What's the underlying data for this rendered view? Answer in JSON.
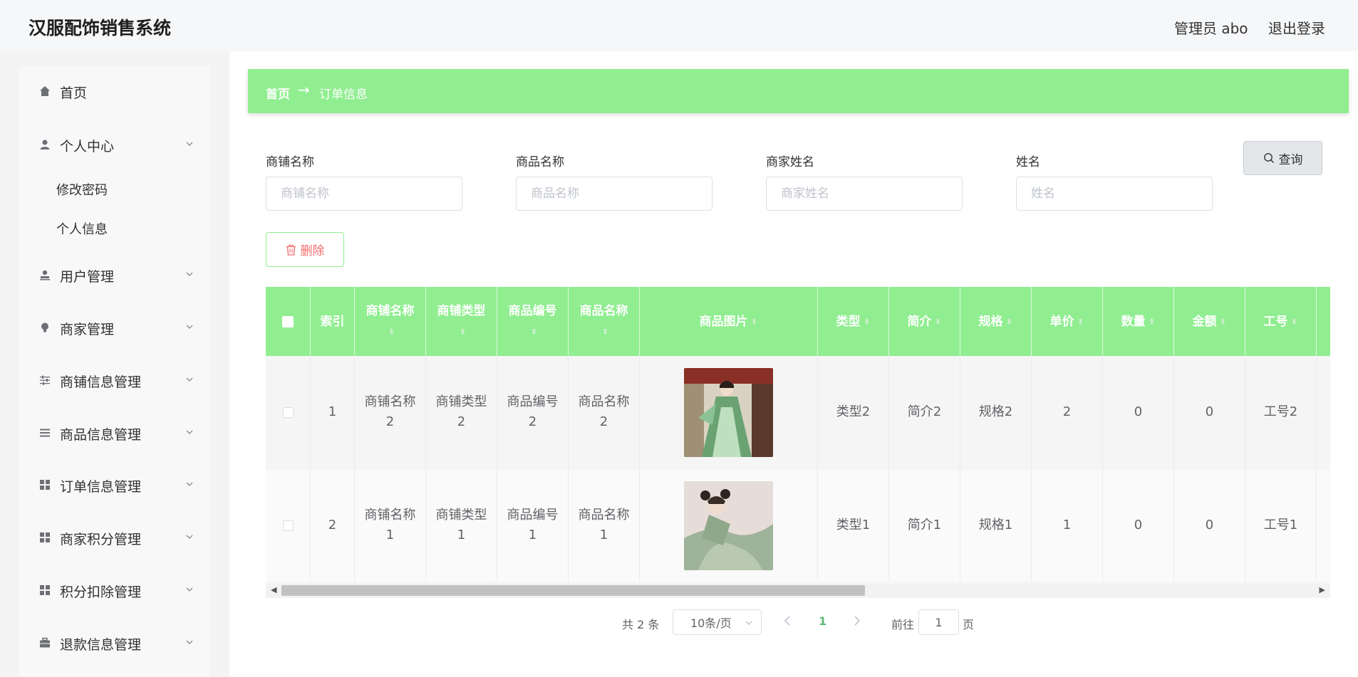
{
  "app": {
    "title": "汉服配饰销售系统"
  },
  "header": {
    "user_label": "管理员 abo",
    "logout_label": "退出登录"
  },
  "sidebar": {
    "items": [
      {
        "label": "首页",
        "icon": "home-icon"
      },
      {
        "label": "个人中心",
        "icon": "user-icon",
        "children": [
          "修改密码",
          "个人信息"
        ]
      },
      {
        "label": "用户管理",
        "icon": "user-stamp-icon"
      },
      {
        "label": "商家管理",
        "icon": "bulb-icon"
      },
      {
        "label": "商铺信息管理",
        "icon": "sliders-icon"
      },
      {
        "label": "商品信息管理",
        "icon": "list-icon"
      },
      {
        "label": "订单信息管理",
        "icon": "grid-icon"
      },
      {
        "label": "商家积分管理",
        "icon": "grid-icon"
      },
      {
        "label": "积分扣除管理",
        "icon": "grid-icon"
      },
      {
        "label": "退款信息管理",
        "icon": "briefcase-icon"
      }
    ]
  },
  "breadcrumb": {
    "home": "首页",
    "separator": "→",
    "current": "订单信息"
  },
  "filters": [
    {
      "label": "商铺名称",
      "placeholder": "商铺名称"
    },
    {
      "label": "商品名称",
      "placeholder": "商品名称"
    },
    {
      "label": "商家姓名",
      "placeholder": "商家姓名"
    },
    {
      "label": "姓名",
      "placeholder": "姓名"
    }
  ],
  "actions": {
    "query_label": "查询",
    "delete_label": "删除"
  },
  "table": {
    "columns": [
      "索引",
      "商铺名称",
      "商铺类型",
      "商品编号",
      "商品名称",
      "商品图片",
      "类型",
      "简介",
      "规格",
      "单价",
      "数量",
      "金额",
      "工号"
    ],
    "rows": [
      {
        "index": "1",
        "shop_name": [
          "商铺名称",
          "2"
        ],
        "shop_type": [
          "商铺类型",
          "2"
        ],
        "product_no": [
          "商品编号",
          "2"
        ],
        "product_name": [
          "商品名称",
          "2"
        ],
        "type": "类型2",
        "intro": "简介2",
        "spec": "规格2",
        "price": "2",
        "qty": "0",
        "amount": "0",
        "job_no": "工号2"
      },
      {
        "index": "2",
        "shop_name": [
          "商铺名称",
          "1"
        ],
        "shop_type": [
          "商铺类型",
          "1"
        ],
        "product_no": [
          "商品编号",
          "1"
        ],
        "product_name": [
          "商品名称",
          "1"
        ],
        "type": "类型1",
        "intro": "简介1",
        "spec": "规格1",
        "price": "1",
        "qty": "0",
        "amount": "0",
        "job_no": "工号1"
      }
    ]
  },
  "pagination": {
    "total_label": "共 2 条",
    "page_size": "10条/页",
    "current_page": "1",
    "goto_label": "前往",
    "goto_value": "1",
    "page_suffix": "页"
  },
  "colors": {
    "accent": "#90ee90",
    "danger": "#f56c6c",
    "page_active": "#5fb878"
  }
}
